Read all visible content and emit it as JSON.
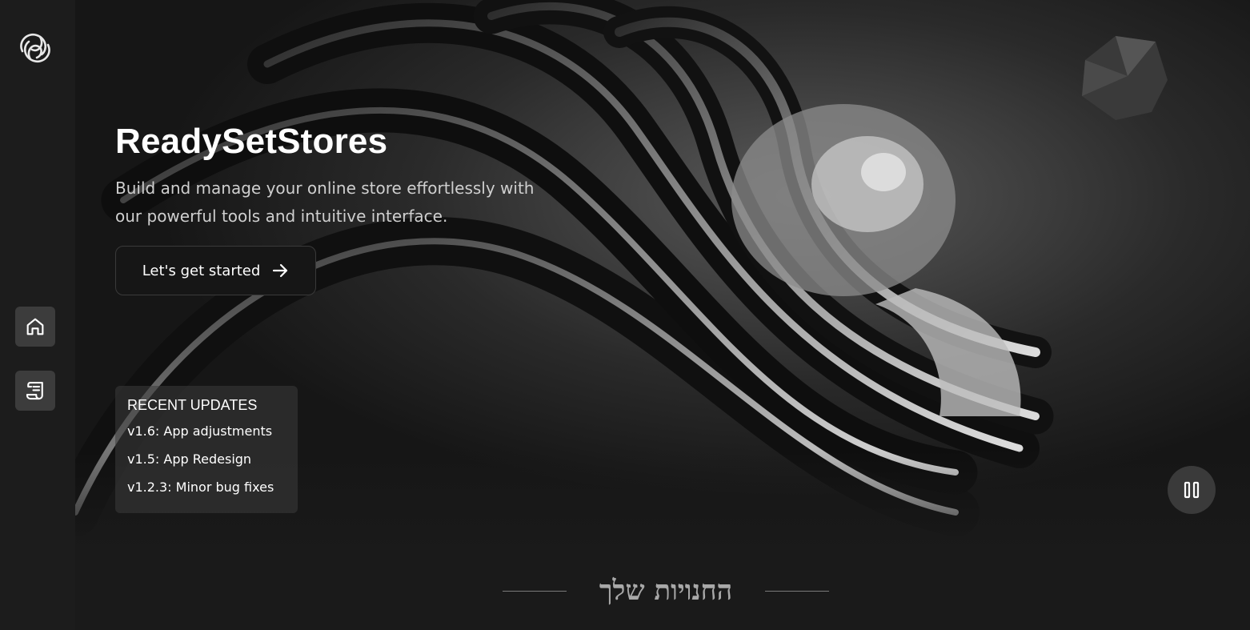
{
  "hero": {
    "title": "ReadySetStores",
    "subtitle": "Build and manage your online store effortlessly with our powerful tools and intuitive interface.",
    "cta_label": "Let's get started"
  },
  "updates": {
    "heading": "RECENT UPDATES",
    "items": [
      "v1.6: App adjustments",
      "v1.5: App Redesign",
      "v1.2.3: Minor bug fixes"
    ]
  },
  "stores_section": {
    "heading": "החנויות שלך"
  },
  "icons": {
    "logo": "swirl-logo-icon",
    "home": "home-icon",
    "updates": "scroll-icon",
    "cta": "arrow-right-icon",
    "pause": "pause-icon"
  },
  "colors": {
    "background": "#1b1b1b",
    "sidebar": "#1c1c1c",
    "nav_button": "#3c3c3c",
    "text_primary": "#ffffff",
    "text_secondary": "#cfcfcf"
  }
}
